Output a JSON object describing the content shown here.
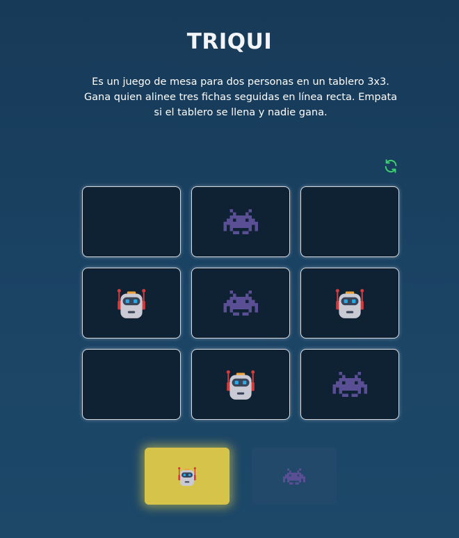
{
  "header": {
    "title": "TRIQUI",
    "description": "Es un juego de mesa para dos personas en un tablero 3x3. Gana quien alinee tres fichas seguidas en línea recta. Empata si el tablero se llena y nadie gana."
  },
  "controls": {
    "reset_icon": "refresh-icon",
    "reset_color": "#3ecf6e"
  },
  "players": {
    "robot": {
      "icon": "robot-icon"
    },
    "alien": {
      "icon": "space-invader-icon"
    }
  },
  "board": {
    "cells": [
      "",
      "alien",
      "",
      "robot",
      "alien",
      "robot",
      "",
      "robot",
      "alien"
    ]
  },
  "turn": {
    "current": "robot",
    "active_color": "#d6c44a",
    "options": [
      "robot",
      "alien"
    ]
  }
}
